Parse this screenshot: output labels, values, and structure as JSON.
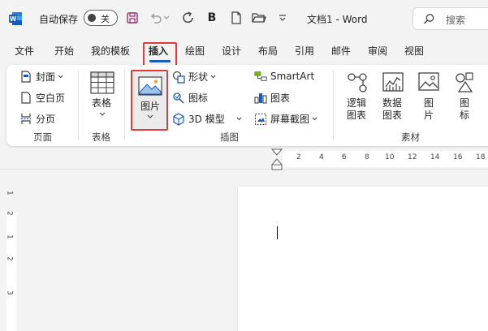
{
  "titlebar": {
    "autosave_label": "自动保存",
    "toggle_state": "关",
    "save_icon": "save-icon",
    "bold_label": "B",
    "doc_title": "文档1 - Word",
    "search_placeholder": "搜索"
  },
  "tabs": [
    "文件",
    "开始",
    "我的模板",
    "插入",
    "绘图",
    "设计",
    "布局",
    "引用",
    "邮件",
    "审阅",
    "视图"
  ],
  "active_tab": "插入",
  "ribbon": {
    "pages": {
      "cover": "封面",
      "blank": "空白页",
      "break": "分页",
      "group": "页面"
    },
    "table": {
      "label": "表格",
      "group": "表格"
    },
    "picture": {
      "label": "图片"
    },
    "illustrations": {
      "shapes": "形状",
      "icons": "图标",
      "model3d": "3D 模型",
      "smartart": "SmartArt",
      "chart": "图表",
      "screenshot": "屏幕截图",
      "group": "插图"
    },
    "assets": {
      "logic_line1": "逻辑",
      "logic_line2": "图表",
      "data_line1": "数据",
      "data_line2": "图表",
      "pic_line1": "图",
      "pic_line2": "片",
      "icon_line1": "图",
      "icon_line2": "标",
      "group": "素材"
    }
  },
  "ruler": {
    "top_numbers": [
      "2",
      "4",
      "6",
      "8",
      "10",
      "12",
      "14",
      "16",
      "18"
    ],
    "left_numbers": [
      "1",
      "2",
      "1",
      "2",
      "3"
    ]
  },
  "colors": {
    "accent": "#185abd",
    "highlight": "#e23a3a",
    "word_blue": "#185abd"
  }
}
